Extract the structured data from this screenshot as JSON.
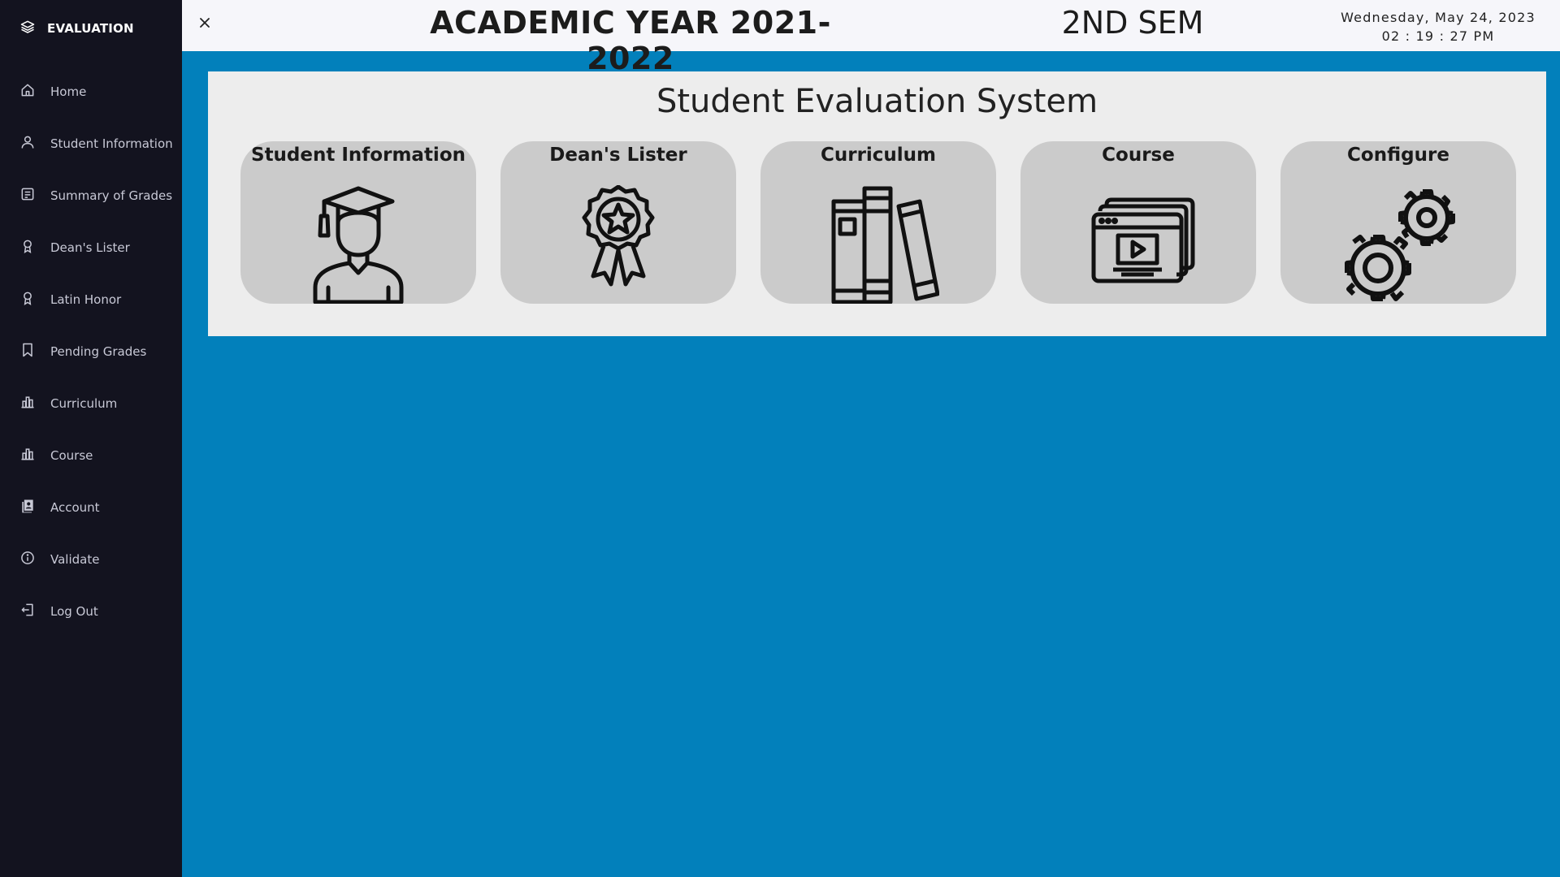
{
  "sidebar": {
    "brand": {
      "label": "EVALUATION",
      "icon": "layers-icon"
    },
    "items": [
      {
        "label": "Home",
        "icon": "home-icon"
      },
      {
        "label": "Student Information",
        "icon": "user-icon"
      },
      {
        "label": "Summary of Grades",
        "icon": "document-icon"
      },
      {
        "label": "Dean's Lister",
        "icon": "award-icon"
      },
      {
        "label": "Latin Honor",
        "icon": "award-icon"
      },
      {
        "label": "Pending Grades",
        "icon": "bookmark-icon"
      },
      {
        "label": "Curriculum",
        "icon": "bar-chart-icon"
      },
      {
        "label": "Course",
        "icon": "bar-chart-icon"
      },
      {
        "label": "Account",
        "icon": "contact-book-icon"
      },
      {
        "label": "Validate",
        "icon": "info-circle-icon"
      },
      {
        "label": "Log Out",
        "icon": "logout-icon"
      }
    ]
  },
  "header": {
    "close_icon": "close-icon",
    "academic_year": "ACADEMIC YEAR 2021-2022",
    "semester": "2ND SEM",
    "date": "Wednesday, May 24, 2023",
    "time": "02 : 19 : 27 PM"
  },
  "main": {
    "title": "Student Evaluation System",
    "cards": [
      {
        "label": "Student Information",
        "icon": "graduate-icon"
      },
      {
        "label": "Dean's Lister",
        "icon": "award-badge-icon"
      },
      {
        "label": "Curriculum",
        "icon": "books-icon"
      },
      {
        "label": "Course",
        "icon": "video-course-icon"
      },
      {
        "label": "Configure",
        "icon": "gears-icon"
      }
    ]
  },
  "colors": {
    "sidebar_bg": "#13131f",
    "topbar_bg": "#f6f6fa",
    "main_bg": "#0280bb",
    "panel_bg": "#ededed",
    "card_bg": "#cbcbcb"
  }
}
